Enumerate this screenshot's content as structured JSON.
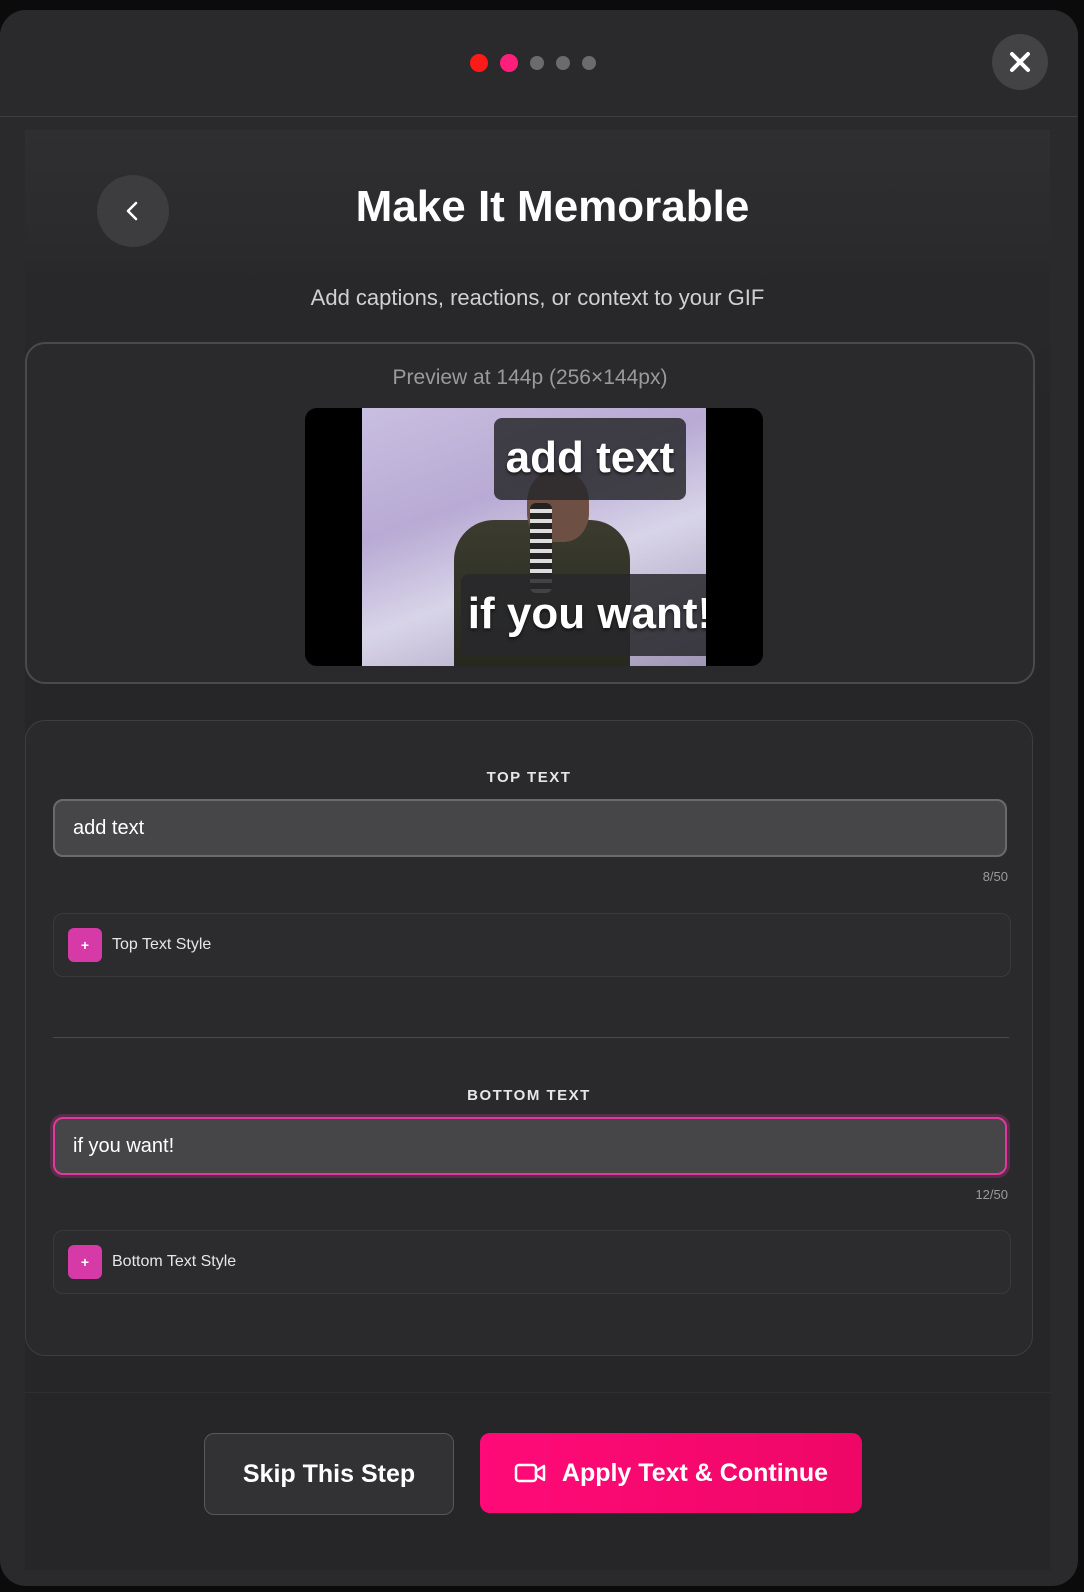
{
  "steps": {
    "total": 5,
    "current": 2
  },
  "header": {
    "title": "Make It Memorable",
    "subtitle": "Add captions, reactions, or context to your GIF"
  },
  "preview": {
    "label": "Preview at 144p (256×144px)",
    "top_caption": "add text",
    "bottom_caption": "if you want!"
  },
  "form": {
    "top": {
      "label": "TOP TEXT",
      "value": "add text",
      "counter": "8/50",
      "style_label": "Top Text Style",
      "style_icon": "+"
    },
    "bottom": {
      "label": "BOTTOM TEXT",
      "value": "if you want!",
      "counter": "12/50",
      "style_label": "Bottom Text Style",
      "style_icon": "+"
    }
  },
  "footer": {
    "skip_label": "Skip This Step",
    "apply_label": "Apply Text & Continue",
    "apply_icon": "video-camera-icon"
  },
  "colors": {
    "accent": "#ff0a78",
    "step_active_1": "#ff1a1a",
    "step_active_2": "#ff1f7a",
    "style_plus": "#d63aa6"
  }
}
